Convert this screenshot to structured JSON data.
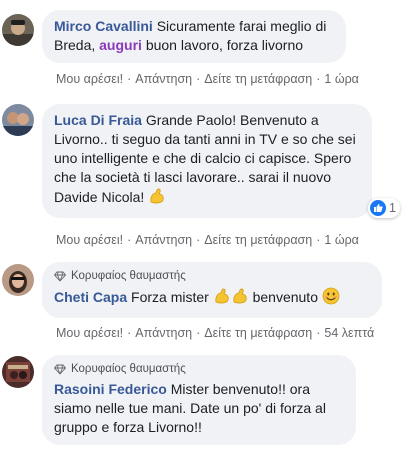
{
  "comments": [
    {
      "author": "Mirco Cavallini",
      "text_before": "Sicuramente farai meglio di Breda,",
      "hashtag": "auguri",
      "text_after": "buon lavoro, forza livorno",
      "actions": {
        "like": "Μου αρέσει!",
        "reply": "Απάντηση",
        "translate": "Δείτε τη μετάφραση",
        "time": "1 ώρα"
      }
    },
    {
      "author": "Luca Di Fraia",
      "text": "Grande Paolo! Benvenuto a Livorno.. ti seguo da tanti anni in TV e so che sei uno intelligente e che di calcio ci capisce. Spero che la società ti lasci lavorare.. sarai il nuovo Davide Nicola!",
      "reaction_count": "1",
      "actions": {
        "like": "Μου αρέσει!",
        "reply": "Απάντηση",
        "translate": "Δείτε τη μετάφραση",
        "time": "1 ώρα"
      }
    },
    {
      "badge": "Κορυφαίος θαυμαστής",
      "author": "Cheti Capa",
      "text_before": "Forza mister",
      "text_after": "benvenuto",
      "actions": {
        "like": "Μου αρέσει!",
        "reply": "Απάντηση",
        "translate": "Δείτε τη μετάφραση",
        "time": "54 λεπτά"
      }
    },
    {
      "badge": "Κορυφαίος θαυμαστής",
      "author": "Rasoini Federico",
      "text": "Mister benvenuto!! ora siamo nelle tue mani. Date un po' di forza al gruppo e forza Livorno!!"
    }
  ],
  "colors": {
    "name": "#385898",
    "hashtag": "#8a3ab9",
    "bubble": "#f0f2f5",
    "meta": "#65676b",
    "like": "#1877f2"
  }
}
